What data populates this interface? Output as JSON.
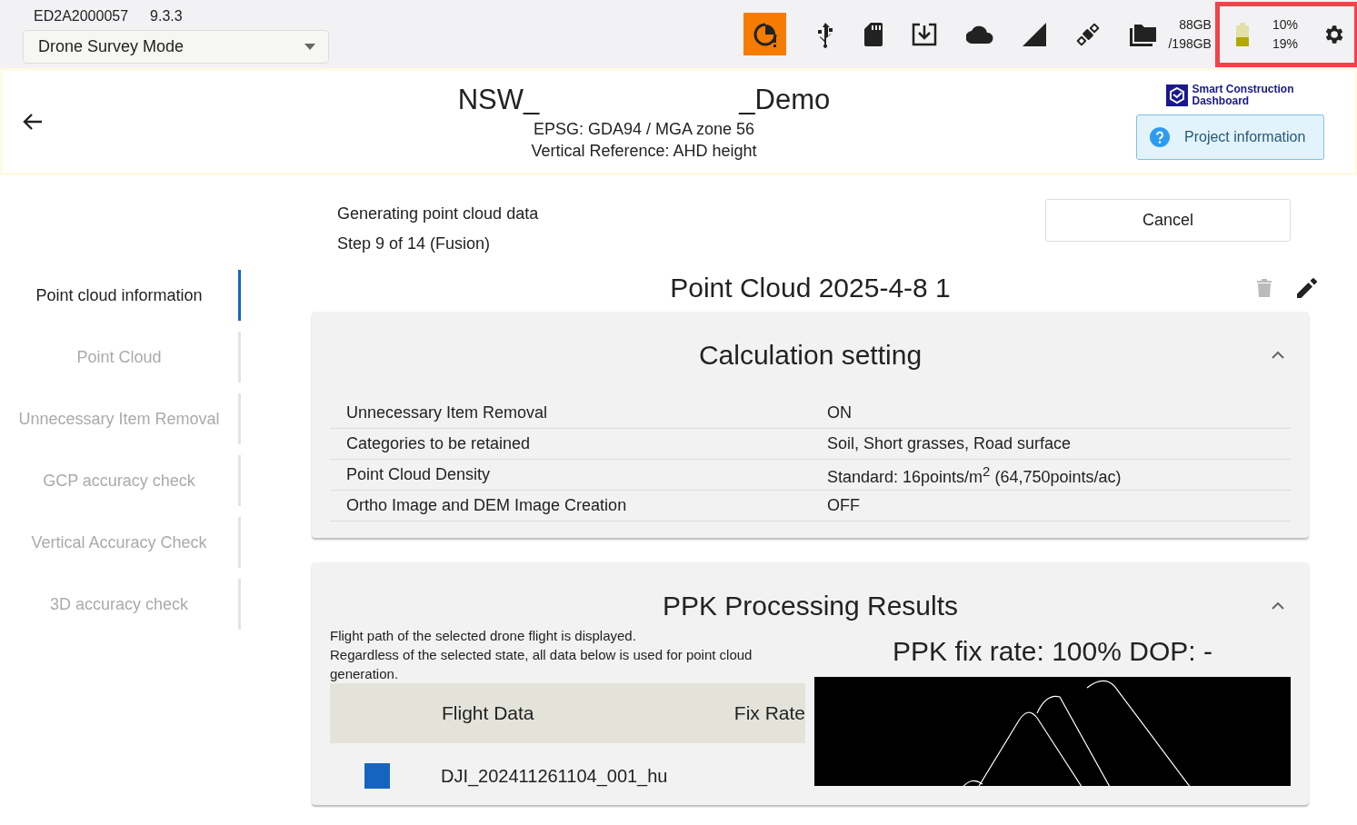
{
  "device": {
    "serial": "ED2A2000057",
    "version": "9.3.3"
  },
  "mode_select": {
    "value": "Drone Survey Mode"
  },
  "storage": {
    "free": "88GB",
    "total": "/198GB"
  },
  "battery": {
    "readings": [
      "10%",
      "19%"
    ]
  },
  "project": {
    "title_start": "NSW_",
    "title_end": "_Demo",
    "crs": "EPSG: GDA94 / MGA zone 56",
    "vertical_reference": "Vertical Reference: AHD height",
    "logo_text": [
      "Smart Construction",
      "Dashboard"
    ],
    "info_button": "Project information"
  },
  "progress": {
    "status": "Generating point cloud data",
    "step": "Step 9 of 14 (Fusion)",
    "cancel_button": "Cancel"
  },
  "sidebar": {
    "items": [
      {
        "label": "Point cloud information",
        "selected": true
      },
      {
        "label": "Point Cloud",
        "selected": false
      },
      {
        "label": "Unnecessary Item Removal",
        "selected": false
      },
      {
        "label": "GCP accuracy check",
        "selected": false
      },
      {
        "label": "Vertical Accuracy Check",
        "selected": false
      },
      {
        "label": "3D accuracy check",
        "selected": false
      }
    ]
  },
  "point_cloud_title": "Point Cloud 2025-4-8 1",
  "calculation": {
    "title": "Calculation setting",
    "expanded": true,
    "rows": [
      {
        "label": "Unnecessary Item Removal",
        "value": "ON"
      },
      {
        "label": "Categories to be retained",
        "value": "Soil, Short grasses, Road surface"
      },
      {
        "label": "Point Cloud Density",
        "value": "Standard: 16points/m$^{2}$ (64,750points/ac)"
      },
      {
        "label": "Ortho Image and DEM Image Creation",
        "value": "OFF"
      }
    ]
  },
  "ppk": {
    "title": "PPK Processing Results",
    "expanded": true,
    "note": [
      "Flight path of the selected drone flight is displayed.",
      "Regardless of the selected state, all data below is used for point cloud generation."
    ],
    "fix_rate": "PPK fix rate: 100%   DOP: -",
    "columns": [
      "Flight Data",
      "Fix Rate"
    ],
    "rows": [
      {
        "name": "DJI_202411261104_001_hu",
        "checked": true
      }
    ]
  }
}
